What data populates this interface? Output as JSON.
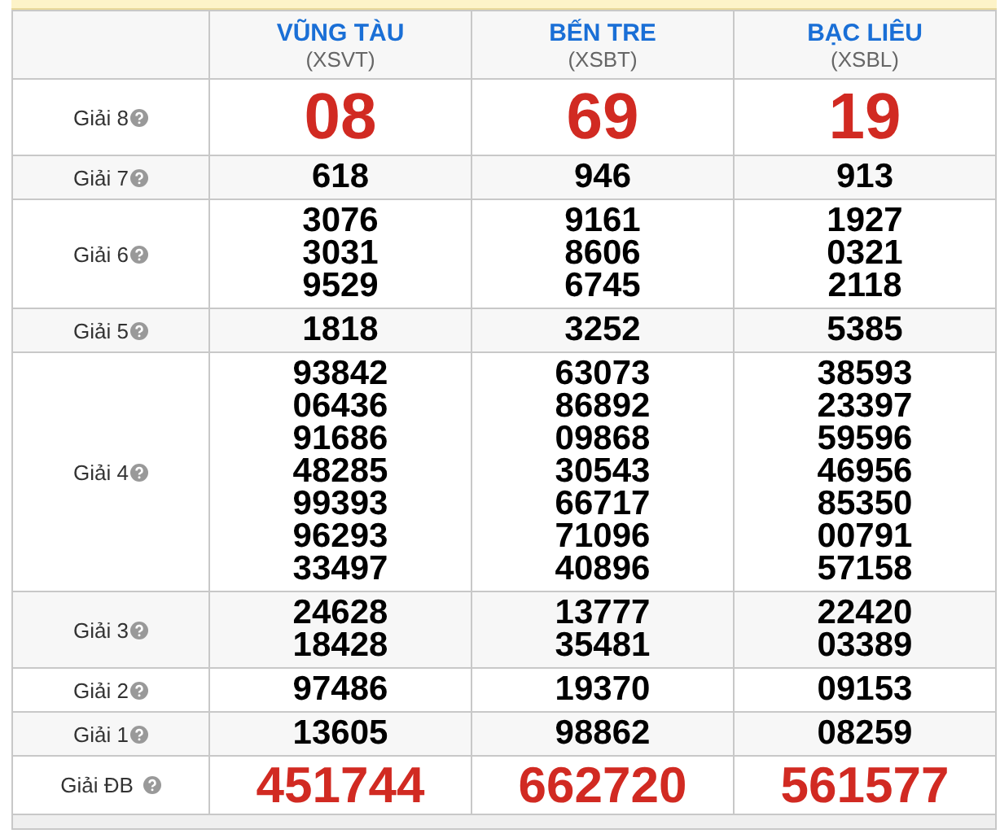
{
  "provinces": [
    {
      "name": "VŨNG TÀU",
      "code": "(XSVT)"
    },
    {
      "name": "BẾN TRE",
      "code": "(XSBT)"
    },
    {
      "name": "BẠC LIÊU",
      "code": "(XSBL)"
    }
  ],
  "prizes": [
    {
      "label": "Giải 8",
      "kind": "big",
      "results": [
        [
          "08"
        ],
        [
          "69"
        ],
        [
          "19"
        ]
      ]
    },
    {
      "label": "Giải 7",
      "kind": "normal",
      "results": [
        [
          "618"
        ],
        [
          "946"
        ],
        [
          "913"
        ]
      ]
    },
    {
      "label": "Giải 6",
      "kind": "normal",
      "results": [
        [
          "3076",
          "3031",
          "9529"
        ],
        [
          "9161",
          "8606",
          "6745"
        ],
        [
          "1927",
          "0321",
          "2118"
        ]
      ]
    },
    {
      "label": "Giải 5",
      "kind": "normal",
      "results": [
        [
          "1818"
        ],
        [
          "3252"
        ],
        [
          "5385"
        ]
      ]
    },
    {
      "label": "Giải 4",
      "kind": "normal",
      "results": [
        [
          "93842",
          "06436",
          "91686",
          "48285",
          "99393",
          "96293",
          "33497"
        ],
        [
          "63073",
          "86892",
          "09868",
          "30543",
          "66717",
          "71096",
          "40896"
        ],
        [
          "38593",
          "23397",
          "59596",
          "46956",
          "85350",
          "00791",
          "57158"
        ]
      ]
    },
    {
      "label": "Giải 3",
      "kind": "normal",
      "results": [
        [
          "24628",
          "18428"
        ],
        [
          "13777",
          "35481"
        ],
        [
          "22420",
          "03389"
        ]
      ]
    },
    {
      "label": "Giải 2",
      "kind": "normal",
      "results": [
        [
          "97486"
        ],
        [
          "19370"
        ],
        [
          "09153"
        ]
      ]
    },
    {
      "label": "Giải 1",
      "kind": "normal",
      "results": [
        [
          "13605"
        ],
        [
          "98862"
        ],
        [
          "08259"
        ]
      ]
    },
    {
      "label": "Giải ĐB",
      "kind": "special",
      "results": [
        [
          "451744"
        ],
        [
          "662720"
        ],
        [
          "561577"
        ]
      ]
    }
  ]
}
